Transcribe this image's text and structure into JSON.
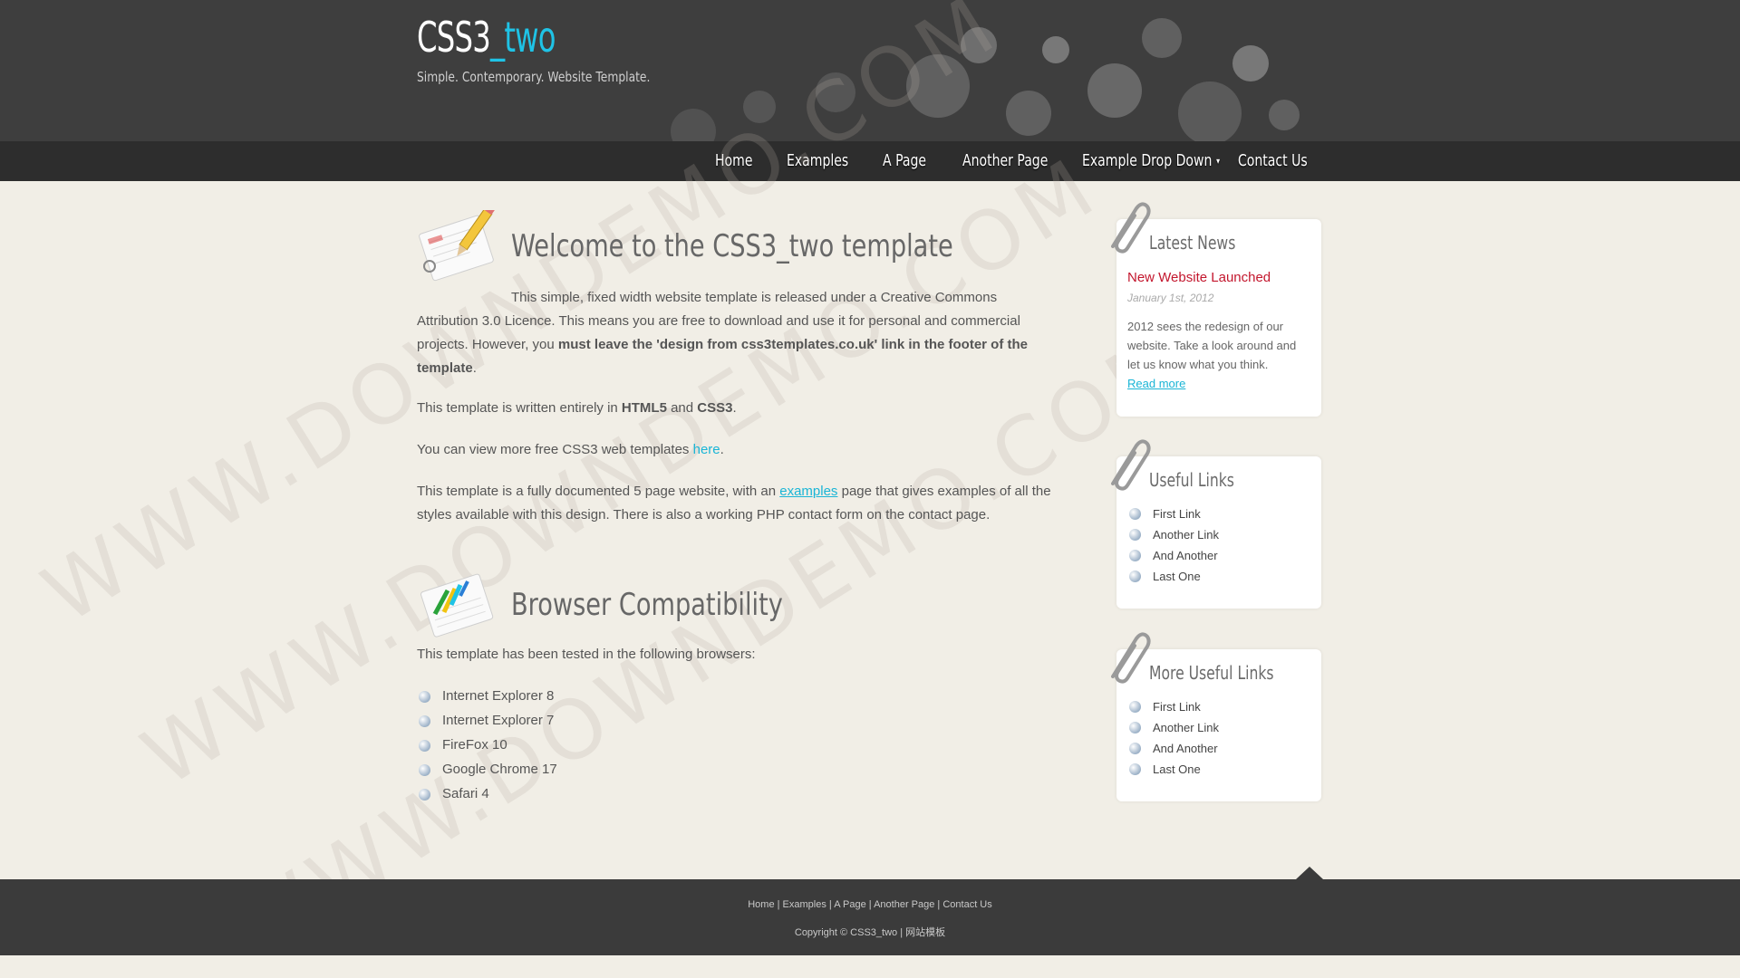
{
  "header": {
    "logo_main": "CSS3",
    "logo_accent": "_two",
    "slogan": "Simple. Contemporary. Website Template."
  },
  "nav": {
    "items": [
      "Home",
      "Examples",
      "A Page",
      "Another Page",
      "Example Drop Down",
      "Contact Us"
    ]
  },
  "watermark": "WWW.DOWNDEMO.COM",
  "main": {
    "welcome_title": "Welcome to the CSS3_two template",
    "p1_text": "This simple, fixed width website template is released under a Creative Commons Attribution 3.0 Licence. This means you are free to download and use it for personal and commercial projects. However, you",
    "p1_bold": "must leave the 'design from css3templates.co.uk' link in the footer of the template",
    "p1_end": ".",
    "p2_a": "This template is written entirely in",
    "p2_html5": "HTML5",
    "p2_and": "and",
    "p2_css3": "CSS3",
    "p2_end": ".",
    "p3_a": "You can view more free CSS3 web templates",
    "p3_link": "here",
    "p3_end": ".",
    "p4_a": "This template is a fully documented 5 page website, with an",
    "p4_link": "examples",
    "p4_b": "page that gives examples of all the styles available with this design. There is also a working PHP contact form on the contact page.",
    "browser_title": "Browser Compatibility",
    "browser_intro": "This template has been tested in the following browsers:",
    "browsers": [
      "Internet Explorer 8",
      "Internet Explorer 7",
      "FireFox 10",
      "Google Chrome 17",
      "Safari 4"
    ]
  },
  "sidebar": {
    "news": {
      "title": "Latest News",
      "item_title": "New Website Launched",
      "item_date": "January 1st, 2012",
      "item_text": "2012 sees the redesign of our website. Take a look around and let us know what you think.",
      "read_more": "Read more"
    },
    "useful": {
      "title": "Useful Links",
      "links": [
        "First Link",
        "Another Link",
        "And Another",
        "Last One"
      ]
    },
    "more_useful": {
      "title": "More Useful Links",
      "links": [
        "First Link",
        "Another Link",
        "And Another",
        "Last One"
      ]
    }
  },
  "footer": {
    "links": [
      "Home",
      "Examples",
      "A Page",
      "Another Page",
      "Contact Us"
    ],
    "separator": "|",
    "copyright": "Copyright © CSS3_two | 网站模板"
  },
  "colors": {
    "accent": "#1fc3e6",
    "header_bg": "#3e3e3e",
    "nav_bg": "#2d2d2d",
    "body_bg": "#f1eee6",
    "news_title": "#c3162d",
    "link": "#1ab5d6"
  }
}
